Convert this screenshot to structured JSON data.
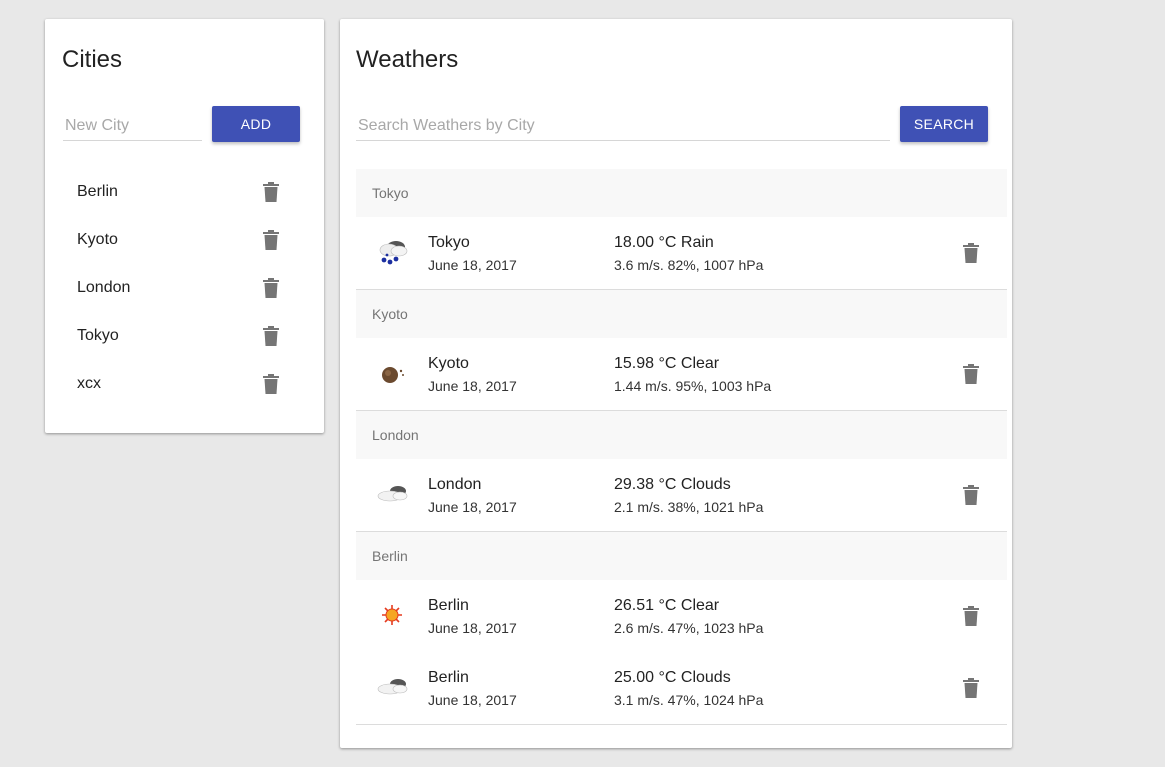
{
  "cities": {
    "title": "Cities",
    "new_city_placeholder": "New City",
    "add_label": "ADD",
    "items": [
      {
        "name": "Berlin"
      },
      {
        "name": "Kyoto"
      },
      {
        "name": "London"
      },
      {
        "name": "Tokyo"
      },
      {
        "name": "xcx"
      }
    ]
  },
  "weathers": {
    "title": "Weathers",
    "search_placeholder": "Search Weathers by City",
    "search_label": "SEARCH",
    "groups": [
      {
        "header": "Tokyo",
        "entries": [
          {
            "city": "Tokyo",
            "date": "June 18, 2017",
            "temp": "18.00 °C Rain",
            "detail": "3.6 m/s. 82%, 1007 hPa",
            "icon": "rain-cloud-icon"
          }
        ]
      },
      {
        "header": "Kyoto",
        "entries": [
          {
            "city": "Kyoto",
            "date": "June 18, 2017",
            "temp": "15.98 °C Clear",
            "detail": "1.44 m/s. 95%, 1003 hPa",
            "icon": "clear-night-icon"
          }
        ]
      },
      {
        "header": "London",
        "entries": [
          {
            "city": "London",
            "date": "June 18, 2017",
            "temp": "29.38 °C Clouds",
            "detail": "2.1 m/s. 38%, 1021 hPa",
            "icon": "clouds-icon"
          }
        ]
      },
      {
        "header": "Berlin",
        "entries": [
          {
            "city": "Berlin",
            "date": "June 18, 2017",
            "temp": "26.51 °C Clear",
            "detail": "2.6 m/s. 47%, 1023 hPa",
            "icon": "sun-icon"
          },
          {
            "city": "Berlin",
            "date": "June 18, 2017",
            "temp": "25.00 °C Clouds",
            "detail": "3.1 m/s. 47%, 1024 hPa",
            "icon": "clouds-icon"
          }
        ]
      }
    ]
  },
  "colors": {
    "accent": "#3f51b5",
    "background": "#e8e8e8",
    "icon_gray": "#757575"
  }
}
